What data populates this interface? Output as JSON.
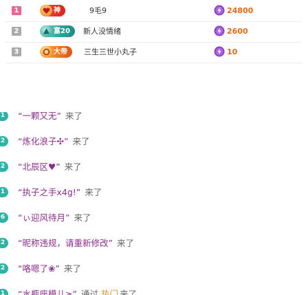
{
  "leaderboard": {
    "rows": [
      {
        "rank": "1",
        "rank_color": "#ee6690",
        "badge_label": "神",
        "badge_color": "#e8382e",
        "badge_icon": "heart-orb-icon",
        "name": "9毛9",
        "score": "24800",
        "score_color": "#e36a1c"
      },
      {
        "rank": "2",
        "rank_color": "#aaaaaa",
        "badge_label": "富20",
        "badge_color": "#2aa59a",
        "badge_icon": "triangle-orb-icon",
        "name": "新人没情绪",
        "score": "2600",
        "score_color": "#e36a1c"
      },
      {
        "rank": "3",
        "rank_color": "#aaaaaa",
        "badge_label": "大帝",
        "badge_color": "#f07a1e",
        "badge_icon": "ring-orb-icon",
        "name": "三生三世小丸子",
        "score": "10",
        "score_color": "#e36a1c"
      }
    ],
    "coin_icon": "purple-coin-icon",
    "coin_color": "#8a3fc4"
  },
  "feed": {
    "messages": [
      {
        "level": "1",
        "level_color": "#2eb4a6",
        "text": "“一颗又无”",
        "suffix": "来了"
      },
      {
        "level": "2",
        "level_color": "#2eb4a6",
        "text": "“炼化浪子✣”",
        "suffix": "来了"
      },
      {
        "level": "2",
        "level_color": "#2eb4a6",
        "text": "“北辰区♥”",
        "suffix": "来了"
      },
      {
        "level": "1",
        "level_color": "#2eb4a6",
        "text": "“执子之手x4g!”",
        "suffix": "来了"
      },
      {
        "level": "6",
        "level_color": "#2eb4a6",
        "text": "“ぃ迎风待月”",
        "suffix": "来了"
      },
      {
        "level": "2",
        "level_color": "#2eb4a6",
        "text": "“昵称违规，请重新修改”",
        "suffix": "来了"
      },
      {
        "level": "2",
        "level_color": "#2eb4a6",
        "text": "“咯嗯了❀”",
        "suffix": "来了"
      },
      {
        "level": "1",
        "level_color": "#2eb4a6",
        "text": "“水瓶座模儿≥”",
        "suffix": "通过",
        "hot": "热门",
        "suffix2": "来了"
      }
    ]
  }
}
